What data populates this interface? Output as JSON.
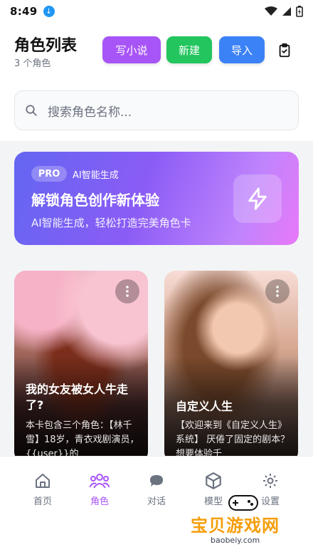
{
  "status_bar": {
    "time": "8:49"
  },
  "header": {
    "title": "角色列表",
    "subtitle": "3 个角色",
    "write_novel_label": "写小说",
    "new_label": "新建",
    "import_label": "导入"
  },
  "search": {
    "placeholder": "搜索角色名称..."
  },
  "pro_banner": {
    "badge": "PRO",
    "tag": "AI智能生成",
    "title": "解锁角色创作新体验",
    "description": "AI智能生成，轻松打造完美角色卡"
  },
  "cards": [
    {
      "title": "我的女友被女人牛走了?",
      "description": "本卡包含三个角色：【林千雪】18岁，青衣戏剧演员，{{user}}的"
    },
    {
      "title": "自定义人生",
      "description": "【欢迎来到《自定义人生》系统】 厌倦了固定的剧本？想要体验千"
    }
  ],
  "tabbar": {
    "home": "首页",
    "roles": "角色",
    "chat": "对话",
    "model": "模型",
    "settings": "设置"
  },
  "watermark": {
    "text": "宝贝游戏网",
    "url": "baobeiy.com"
  },
  "colors": {
    "accent": "#a855f7",
    "new_button": "#22c55e",
    "import_button": "#3b82f6"
  }
}
